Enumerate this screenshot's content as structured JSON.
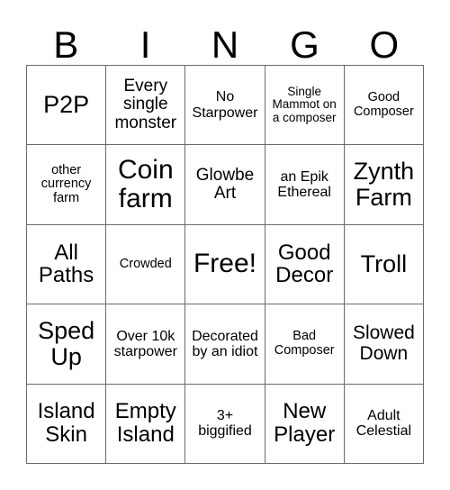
{
  "card": {
    "title": "BINGO",
    "headers": [
      "B",
      "I",
      "N",
      "G",
      "O"
    ],
    "grid_size": 5,
    "colors": {
      "background": "#ffffff",
      "text": "#000000",
      "grid_line": "#6b6b6b"
    },
    "free_space": {
      "row": 3,
      "column": 3,
      "label": "Free!"
    },
    "rows": [
      {
        "cells": [
          {
            "label": "P2P",
            "size": "fs-xl"
          },
          {
            "label": "Every single monster",
            "size": "fs-m"
          },
          {
            "label": "No Starpower",
            "size": "fs-ms"
          },
          {
            "label": "Single Mammot on a composer",
            "size": "fs-xs"
          },
          {
            "label": "Good Composer",
            "size": "fs-s"
          }
        ]
      },
      {
        "cells": [
          {
            "label": "other currency farm",
            "size": "fs-s"
          },
          {
            "label": "Coin farm",
            "size": "fs-xxl"
          },
          {
            "label": "Glowbe Art",
            "size": "fs-m"
          },
          {
            "label": "an Epik Ethereal",
            "size": "fs-ms"
          },
          {
            "label": "Zynth Farm",
            "size": "fs-xl"
          }
        ]
      },
      {
        "cells": [
          {
            "label": "All Paths",
            "size": "fs-l"
          },
          {
            "label": "Crowded",
            "size": "fs-s"
          },
          {
            "label": "Free!",
            "size": "fs-xxl"
          },
          {
            "label": "Good Decor",
            "size": "fs-l"
          },
          {
            "label": "Troll",
            "size": "fs-xl"
          }
        ]
      },
      {
        "cells": [
          {
            "label": "Sped Up",
            "size": "fs-xl"
          },
          {
            "label": "Over 10k starpower",
            "size": "fs-ms"
          },
          {
            "label": "Decorated by an idiot",
            "size": "fs-ms"
          },
          {
            "label": "Bad Composer",
            "size": "fs-s"
          },
          {
            "label": "Slowed Down",
            "size": "fs-ml"
          }
        ]
      },
      {
        "cells": [
          {
            "label": "Island Skin",
            "size": "fs-l"
          },
          {
            "label": "Empty Island",
            "size": "fs-l"
          },
          {
            "label": "3+ biggified",
            "size": "fs-ms"
          },
          {
            "label": "New Player",
            "size": "fs-l"
          },
          {
            "label": "Adult Celestial",
            "size": "fs-ms"
          }
        ]
      }
    ]
  }
}
